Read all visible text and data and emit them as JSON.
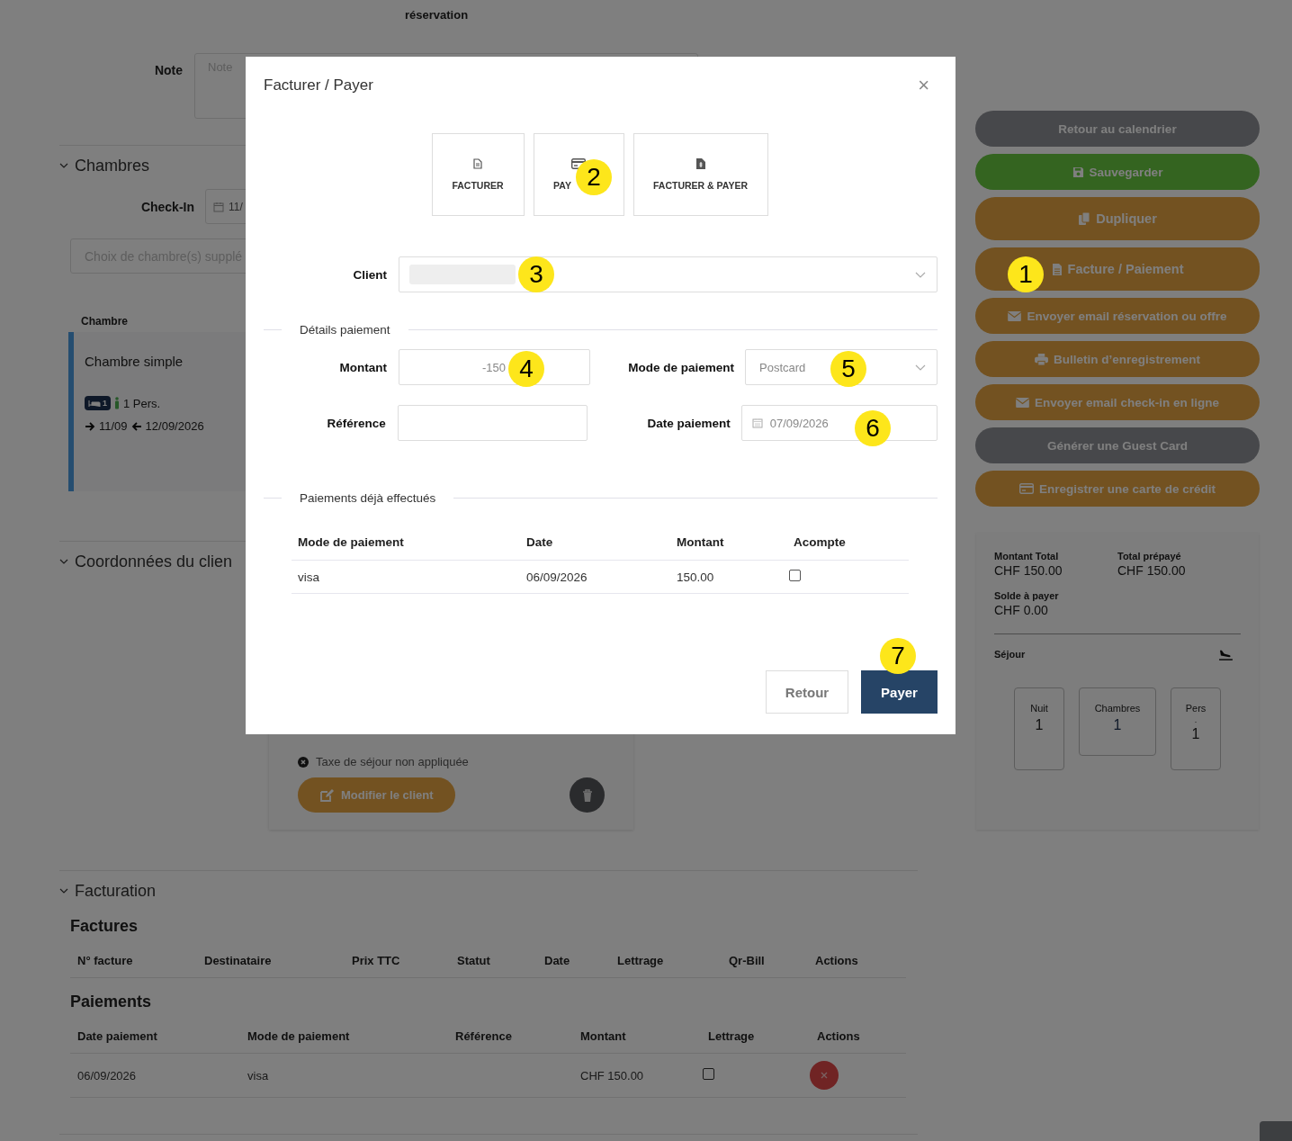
{
  "background_page": {
    "header_fragment": "réservation",
    "note": {
      "label": "Note",
      "placeholder": "Note"
    },
    "rooms_section": {
      "title": "Chambres",
      "checkin": {
        "label": "Check-In",
        "value": "11/"
      },
      "room_picker": {
        "placeholder": "Choix de chambre(s) supplé"
      },
      "column": "Chambre",
      "room": {
        "name": "Chambre simple",
        "beds": "1",
        "persons": "1 Pers.",
        "arrival": "11/09",
        "departure": "12/09/2026"
      }
    },
    "client_section": {
      "title": "Coordonnées du clien",
      "tax_note": "Taxe de séjour non appliquée",
      "edit_button": "Modifier le client"
    },
    "billing_section": {
      "title": "Facturation",
      "invoices": {
        "title": "Factures",
        "columns": [
          "N° facture",
          "Destinataire",
          "Prix TTC",
          "Statut",
          "Date",
          "Lettrage",
          "Qr-Bill",
          "Actions"
        ]
      },
      "payments": {
        "title": "Paiements",
        "columns": [
          "Date paiement",
          "Mode de paiement",
          "Référence",
          "Montant",
          "Lettrage",
          "Actions"
        ],
        "rows": [
          {
            "date": "06/09/2026",
            "method": "visa",
            "amount": "CHF 150.00",
            "checked": false
          }
        ]
      }
    }
  },
  "actions": [
    {
      "label": "Retour au calendrier",
      "kind": "neutral"
    },
    {
      "label": "Sauvegarder",
      "kind": "success"
    },
    {
      "label": "Dupliquer",
      "kind": "warning"
    },
    {
      "label": "Facture / Paiement",
      "kind": "warning"
    },
    {
      "label": "Envoyer email réservation ou offre",
      "kind": "warning"
    },
    {
      "label": "Bulletin d’enregistrement",
      "kind": "warning"
    },
    {
      "label": "Envoyer email check-in en ligne",
      "kind": "warning"
    },
    {
      "label": "Générer une Guest Card",
      "kind": "neutral"
    },
    {
      "label": "Enregistrer une carte de crédit",
      "kind": "warning"
    }
  ],
  "summary": {
    "total_label": "Montant Total",
    "total": "CHF 150.00",
    "prepaid_label": "Total prépayé",
    "prepaid": "CHF 150.00",
    "balance_label": "Solde à payer",
    "balance": "CHF 0.00",
    "stay_label": "Séjour",
    "stats": [
      {
        "label": "Nuit",
        "value": "1"
      },
      {
        "label": "Chambres",
        "value": "1"
      },
      {
        "label": "Pers",
        "sub": ".",
        "value": "1"
      }
    ]
  },
  "dialog": {
    "title": "Facturer / Payer",
    "close": "×",
    "modes": [
      {
        "label": "FACTURER"
      },
      {
        "label": "PAY"
      },
      {
        "label": "FACTURER & PAYER"
      }
    ],
    "client": {
      "label": "Client"
    },
    "details_legend": "Détails paiement",
    "amount": {
      "label": "Montant",
      "value": "-150"
    },
    "method": {
      "label": "Mode de paiement",
      "value": "Postcard"
    },
    "reference": {
      "label": "Référence"
    },
    "date": {
      "label": "Date paiement",
      "value": "07/09/2026"
    },
    "payments_legend": "Paiements déjà effectués",
    "columns": [
      "Mode de paiement",
      "Date",
      "Montant",
      "Acompte"
    ],
    "rows": [
      {
        "method": "visa",
        "date": "06/09/2026",
        "amount": "150.00",
        "checked": false
      }
    ],
    "buttons": [
      "Retour",
      "Payer"
    ]
  },
  "annotations": [
    "1",
    "2",
    "3",
    "4",
    "5",
    "6",
    "7"
  ]
}
